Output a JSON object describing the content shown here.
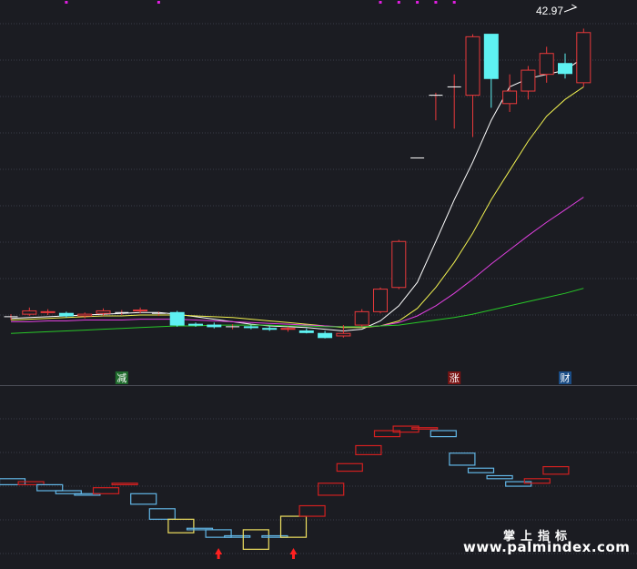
{
  "colors": {
    "background": "#1b1c22",
    "grid": "#3a3d48",
    "separator": "#4a4c55",
    "up": "#e8393b",
    "down": "#5ef2f2",
    "ma5": "#ffffff",
    "ma10": "#f0f050",
    "ma20": "#e040e0",
    "ma60": "#28c828",
    "indicator_up": "#d02020",
    "indicator_down": "#62b6e6",
    "indicator_flag": "#f0e060",
    "arrow": "#ff2020",
    "marker": "#e01ee0",
    "tag_reduce_bg": "#1f6b2c",
    "tag_rise_bg": "#7a1414",
    "tag_finance_bg": "#1b4d86",
    "watermark": "#ffffff"
  },
  "watermark": {
    "line1": "掌上指标",
    "line2": "www.palmindex.com"
  },
  "chart_data": [
    {
      "type": "candlestick",
      "max_label": "42.97",
      "ylim": [
        5,
        44
      ],
      "x_count": 32,
      "grid": true,
      "ma_lines": [
        "ma5",
        "ma10",
        "ma20",
        "ma60"
      ],
      "candles": [
        {
          "o": 8.5,
          "c": 8.5,
          "h": 8.8,
          "l": 8.1
        },
        {
          "o": 8.8,
          "c": 9.2,
          "h": 9.6,
          "l": 8.6
        },
        {
          "o": 9.0,
          "c": 9.1,
          "h": 9.4,
          "l": 8.7
        },
        {
          "o": 8.9,
          "c": 8.6,
          "h": 9.1,
          "l": 8.4
        },
        {
          "o": 8.6,
          "c": 8.8,
          "h": 9.0,
          "l": 8.3
        },
        {
          "o": 8.9,
          "c": 9.2,
          "h": 9.5,
          "l": 8.6
        },
        {
          "o": 9.0,
          "c": 9.0,
          "h": 9.3,
          "l": 8.7
        },
        {
          "o": 9.2,
          "c": 9.3,
          "h": 9.6,
          "l": 8.9
        },
        {
          "o": 8.9,
          "c": 8.9,
          "h": 9.1,
          "l": 8.6
        },
        {
          "o": 9.0,
          "c": 7.5,
          "h": 9.2,
          "l": 7.3
        },
        {
          "o": 7.6,
          "c": 7.5,
          "h": 7.8,
          "l": 7.3
        },
        {
          "o": 7.5,
          "c": 7.3,
          "h": 7.8,
          "l": 7.1
        },
        {
          "o": 7.3,
          "c": 7.3,
          "h": 7.6,
          "l": 7.0
        },
        {
          "o": 7.3,
          "c": 7.2,
          "h": 7.5,
          "l": 7.0
        },
        {
          "o": 7.1,
          "c": 7.0,
          "h": 7.4,
          "l": 6.8
        },
        {
          "o": 7.0,
          "c": 7.1,
          "h": 7.3,
          "l": 6.7
        },
        {
          "o": 6.8,
          "c": 6.6,
          "h": 7.1,
          "l": 6.5
        },
        {
          "o": 6.5,
          "c": 6.0,
          "h": 6.8,
          "l": 5.9
        },
        {
          "o": 6.2,
          "c": 6.5,
          "h": 7.5,
          "l": 6.0
        },
        {
          "o": 7.5,
          "c": 9.1,
          "h": 9.4,
          "l": 7.3
        },
        {
          "o": 9.1,
          "c": 11.8,
          "h": 12.0,
          "l": 8.9
        },
        {
          "o": 12.0,
          "c": 17.5,
          "h": 17.7,
          "l": 11.8
        },
        {
          "o": 27.5,
          "c": 27.5,
          "h": 27.5,
          "l": 27.5
        },
        {
          "o": 35.0,
          "c": 35.0,
          "h": 35.3,
          "l": 32.0
        },
        {
          "o": 36.0,
          "c": 36.0,
          "h": 37.5,
          "l": 31.0
        },
        {
          "o": 35.0,
          "c": 42.0,
          "h": 42.3,
          "l": 30.0
        },
        {
          "o": 42.3,
          "c": 37.0,
          "h": 42.3,
          "l": 33.5
        },
        {
          "o": 34.0,
          "c": 35.5,
          "h": 37.5,
          "l": 33.0
        },
        {
          "o": 35.5,
          "c": 38.0,
          "h": 38.5,
          "l": 34.5
        },
        {
          "o": 37.5,
          "c": 40.0,
          "h": 40.8,
          "l": 36.5
        },
        {
          "o": 38.8,
          "c": 37.6,
          "h": 40.0,
          "l": 37.0
        },
        {
          "o": 36.5,
          "c": 42.5,
          "h": 42.97,
          "l": 36.0
        }
      ],
      "ma5": [
        8.3,
        8.4,
        8.5,
        8.6,
        8.7,
        8.8,
        8.9,
        9.0,
        9.0,
        8.8,
        8.5,
        8.2,
        7.9,
        7.6,
        7.4,
        7.3,
        7.2,
        7.0,
        6.8,
        7.0,
        8.0,
        9.8,
        12.6,
        17.5,
        22.5,
        27.0,
        32.0,
        36.0,
        37.0,
        37.5,
        38.0,
        39.5
      ],
      "ma10": [
        8.1,
        8.2,
        8.3,
        8.4,
        8.5,
        8.6,
        8.6,
        8.7,
        8.7,
        8.7,
        8.6,
        8.5,
        8.4,
        8.2,
        8.0,
        7.8,
        7.6,
        7.4,
        7.2,
        7.2,
        7.4,
        8.0,
        9.5,
        12.0,
        15.0,
        18.5,
        22.5,
        26.0,
        29.5,
        32.5,
        34.5,
        36.0
      ],
      "ma20": [
        7.9,
        7.9,
        8.0,
        8.0,
        8.1,
        8.1,
        8.1,
        8.2,
        8.2,
        8.2,
        8.1,
        8.0,
        7.9,
        7.8,
        7.7,
        7.6,
        7.5,
        7.4,
        7.3,
        7.3,
        7.4,
        7.8,
        8.6,
        9.8,
        11.3,
        13.0,
        14.8,
        16.5,
        18.2,
        19.8,
        21.3,
        22.8
      ],
      "ma60": [
        6.5,
        6.6,
        6.7,
        6.8,
        6.9,
        7.0,
        7.1,
        7.2,
        7.3,
        7.4,
        7.4,
        7.5,
        7.5,
        7.5,
        7.5,
        7.4,
        7.4,
        7.3,
        7.3,
        7.3,
        7.4,
        7.5,
        7.8,
        8.1,
        8.4,
        8.8,
        9.3,
        9.8,
        10.3,
        10.8,
        11.3,
        11.9
      ],
      "top_markers": [
        3,
        8,
        20,
        21,
        22,
        23,
        24
      ],
      "signal_tags": [
        {
          "index": 6,
          "text": "减",
          "kind": "reduce"
        },
        {
          "index": 24,
          "text": "涨",
          "kind": "rise"
        },
        {
          "index": 30,
          "text": "财",
          "kind": "finance"
        }
      ]
    },
    {
      "type": "step-boxes",
      "ylim": [
        0,
        100
      ],
      "grid": true,
      "boxes": [
        {
          "v1": 48,
          "v2": 44,
          "color": "down"
        },
        {
          "v1": 46,
          "v2": 44,
          "color": "up"
        },
        {
          "v1": 44,
          "v2": 40,
          "color": "down"
        },
        {
          "v1": 40,
          "v2": 38,
          "color": "down"
        },
        {
          "v1": 38,
          "v2": 37,
          "color": "down"
        },
        {
          "v1": 42,
          "v2": 38,
          "color": "up"
        },
        {
          "v1": 45,
          "v2": 44,
          "color": "up"
        },
        {
          "v1": 38,
          "v2": 31,
          "color": "down"
        },
        {
          "v1": 28,
          "v2": 21,
          "color": "down"
        },
        {
          "v1": 21,
          "v2": 12,
          "color": "flag"
        },
        {
          "v1": 15,
          "v2": 14,
          "color": "down"
        },
        {
          "v1": 14,
          "v2": 9,
          "color": "down"
        },
        {
          "v1": 10,
          "v2": 9,
          "color": "down"
        },
        {
          "v1": 14,
          "v2": 1,
          "color": "flag"
        },
        {
          "v1": 10,
          "v2": 9,
          "color": "down"
        },
        {
          "v1": 23,
          "v2": 9,
          "color": "flag"
        },
        {
          "v1": 30,
          "v2": 23,
          "color": "up"
        },
        {
          "v1": 45,
          "v2": 37,
          "color": "up"
        },
        {
          "v1": 58,
          "v2": 53,
          "color": "up"
        },
        {
          "v1": 70,
          "v2": 64,
          "color": "up"
        },
        {
          "v1": 80,
          "v2": 76,
          "color": "up"
        },
        {
          "v1": 83,
          "v2": 79,
          "color": "up"
        },
        {
          "v1": 82,
          "v2": 81,
          "color": "up"
        },
        {
          "v1": 80,
          "v2": 76,
          "color": "down"
        },
        {
          "v1": 65,
          "v2": 57,
          "color": "down"
        },
        {
          "v1": 55,
          "v2": 52,
          "color": "down"
        },
        {
          "v1": 50,
          "v2": 48,
          "color": "down"
        },
        {
          "v1": 46,
          "v2": 43,
          "color": "down"
        },
        {
          "v1": 48,
          "v2": 45,
          "color": "up"
        },
        {
          "v1": 56,
          "v2": 51,
          "color": "up"
        }
      ],
      "arrows": [
        11,
        15
      ]
    }
  ]
}
